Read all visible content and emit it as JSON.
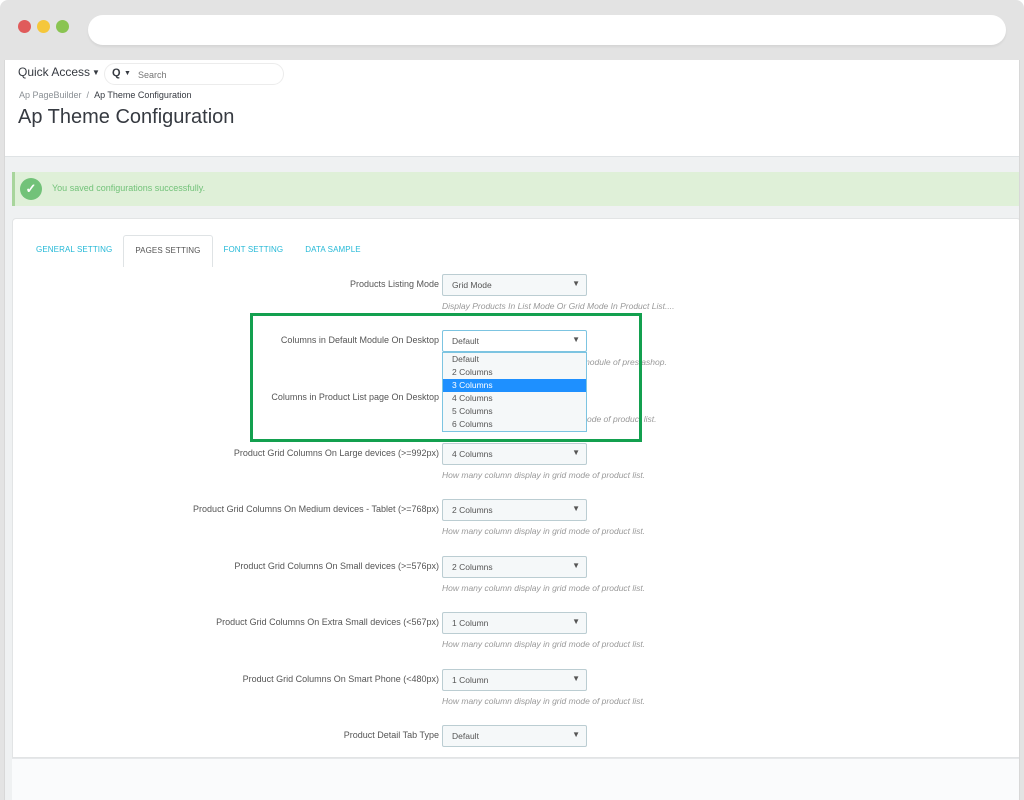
{
  "browser": {
    "window_controls": [
      "close",
      "minimize",
      "maximize"
    ],
    "url": ""
  },
  "header": {
    "quick_access_label": "Quick Access",
    "search_placeholder": "Search",
    "breadcrumb": [
      "Ap PageBuilder",
      "Ap Theme Configuration"
    ],
    "breadcrumb_separator": "/",
    "title": "Ap Theme Configuration"
  },
  "alert": {
    "type": "success",
    "message": "You saved configurations successfully.",
    "color": "#72c279"
  },
  "tabs": [
    {
      "label": "General Setting",
      "active": false
    },
    {
      "label": "Pages Setting",
      "active": true
    },
    {
      "label": "Font Setting",
      "active": false
    },
    {
      "label": "Data Sample",
      "active": false
    }
  ],
  "form": {
    "fields": [
      {
        "label": "Products Listing Mode",
        "value": "Grid Mode",
        "help": "Display Products In List Mode Or Grid Mode In Product List...."
      },
      {
        "label": "Columns in Default Module On Desktop",
        "value": "Default",
        "help": "Column display in default module of prestashop."
      },
      {
        "label": "Columns in Product List page On Desktop",
        "value": "",
        "help": "How many column display in grid mode of product list."
      },
      {
        "label": "Product Grid Columns On Large devices (>=992px)",
        "value": "4 Columns",
        "help": "How many column display in grid mode of product list."
      },
      {
        "label": "Product Grid Columns On Medium devices - Tablet (>=768px)",
        "value": "2 Columns",
        "help": "How many column display in grid mode of product list."
      },
      {
        "label": "Product Grid Columns On Small devices (>=576px)",
        "value": "2 Columns",
        "help": "How many column display in grid mode of product list."
      },
      {
        "label": "Product Grid Columns On Extra Small devices (<567px)",
        "value": "1 Column",
        "help": "How many column display in grid mode of product list."
      },
      {
        "label": "Product Grid Columns On Smart Phone (<480px)",
        "value": "1 Column",
        "help": "How many column display in grid mode of product list."
      },
      {
        "label": "Product Detail Tab Type",
        "value": "Default",
        "help": ""
      }
    ],
    "open_dropdown": {
      "options": [
        "Default",
        "2 Columns",
        "3 Columns",
        "4 Columns",
        "5 Columns",
        "6 Columns"
      ],
      "highlighted": "3 Columns"
    },
    "arrow_glyph": "▼"
  },
  "help_visible_fragments": {
    "row2": "t module of prestashop.",
    "row3": "ode of product list."
  },
  "colors": {
    "accent": "#25b9d7",
    "highlight_box": "#13a04f",
    "selected_option": "#1e90ff"
  }
}
